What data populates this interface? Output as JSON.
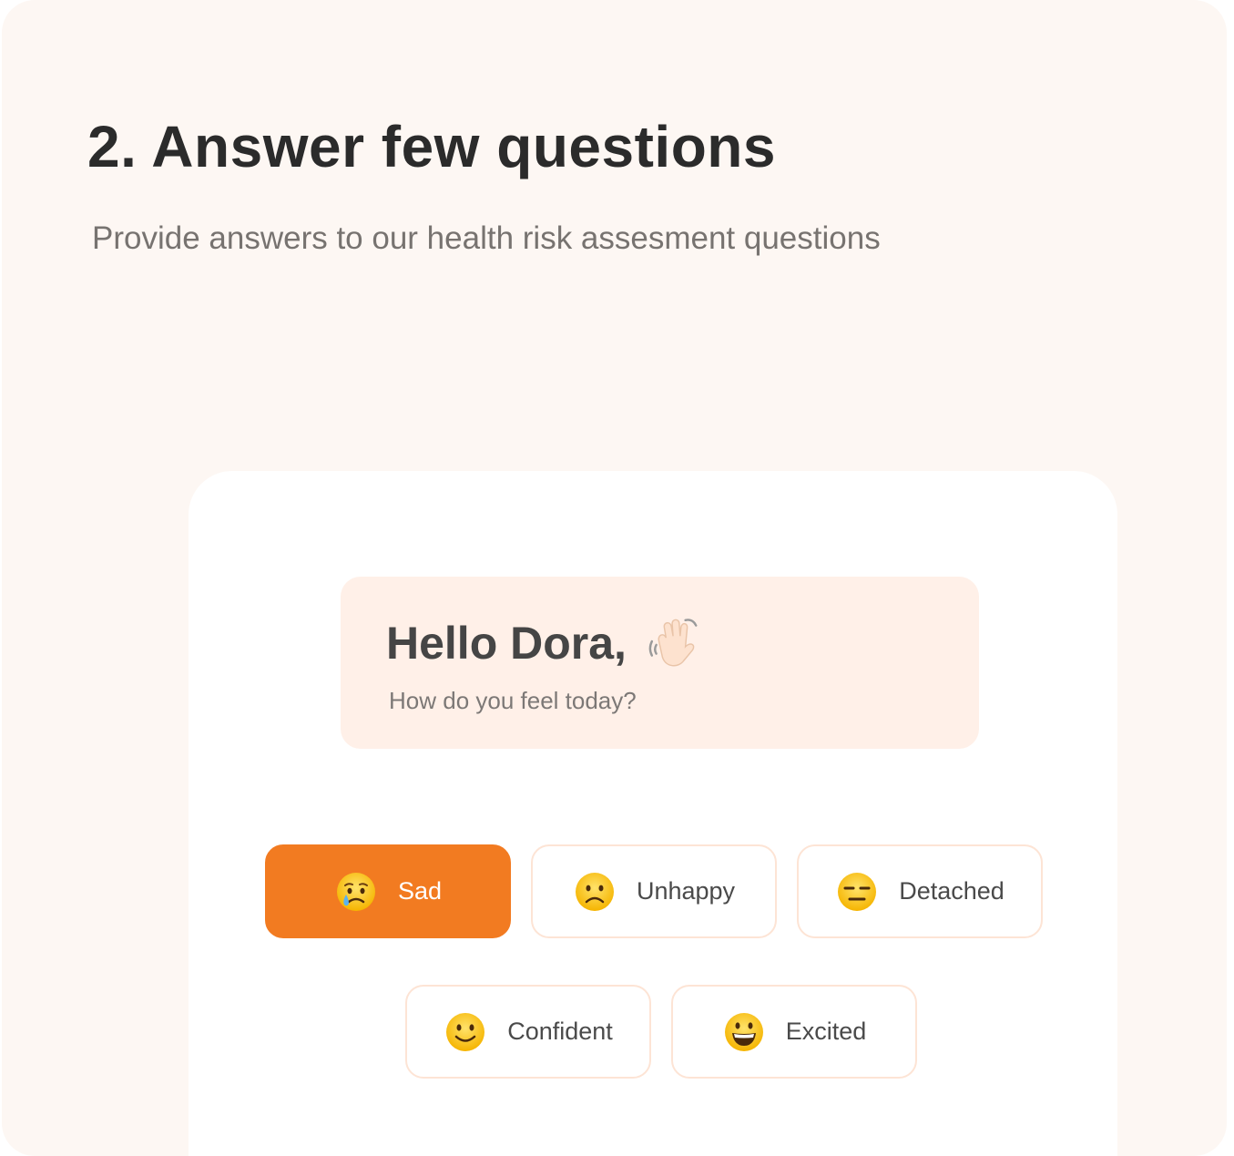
{
  "header": {
    "title": "2. Answer few questions",
    "subtitle": "Provide answers to our health risk assesment questions"
  },
  "greeting": {
    "title": "Hello Dora,",
    "icon": "waving-hand-icon",
    "question": "How do you feel today?"
  },
  "moods": [
    {
      "label": "Sad",
      "icon": "crying-face-icon",
      "selected": true
    },
    {
      "label": "Unhappy",
      "icon": "frowning-face-icon",
      "selected": false
    },
    {
      "label": "Detached",
      "icon": "expressionless-face-icon",
      "selected": false
    },
    {
      "label": "Confident",
      "icon": "slightly-smiling-face-icon",
      "selected": false
    },
    {
      "label": "Excited",
      "icon": "grinning-face-icon",
      "selected": false
    }
  ],
  "colors": {
    "accent": "#f27b21",
    "background": "#fdf7f3",
    "greeting_bg": "#fff0e8",
    "button_border": "#fde4d5"
  }
}
